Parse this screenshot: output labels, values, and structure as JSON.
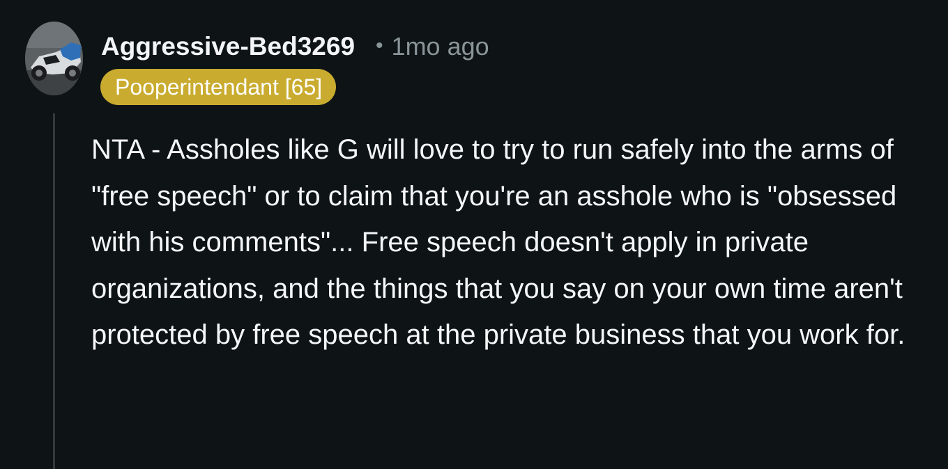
{
  "comment": {
    "avatar_icon": "motorcycle-avatar-icon",
    "username": "Aggressive-Bed3269",
    "separator": "•",
    "timestamp": "1mo ago",
    "flair": "Pooperintendant [65]",
    "flair_color": "#c9ab2f",
    "body": "NTA - Assholes like G will love to try to run safely into the arms of \"free speech\" or to claim that you're an asshole who is \"obsessed with his comments\"... Free speech doesn't apply in private organizations, and the things that you say on your own time aren't protected by free speech at the private business that you work for."
  }
}
